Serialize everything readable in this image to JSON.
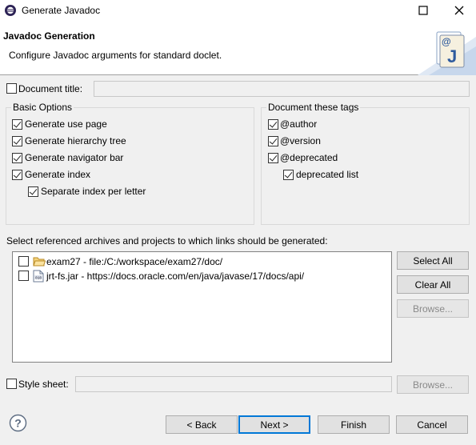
{
  "window": {
    "title": "Generate Javadoc",
    "maximize_icon": "maximize-icon",
    "close_icon": "close-icon"
  },
  "banner": {
    "title": "Javadoc Generation",
    "description": "Configure Javadoc arguments for standard doclet.",
    "image_icon": "javadoc-wizard-icon"
  },
  "document_title": {
    "label": "Document title:",
    "checked": false,
    "value": ""
  },
  "basic_options": {
    "title": "Basic Options",
    "items": [
      {
        "label": "Generate use page",
        "checked": true
      },
      {
        "label": "Generate hierarchy tree",
        "checked": true
      },
      {
        "label": "Generate navigator bar",
        "checked": true
      },
      {
        "label": "Generate index",
        "checked": true
      },
      {
        "label": "Separate index per letter",
        "checked": true
      }
    ]
  },
  "document_tags": {
    "title": "Document these tags",
    "items": [
      {
        "label": "@author",
        "checked": true
      },
      {
        "label": "@version",
        "checked": true
      },
      {
        "label": "@deprecated",
        "checked": true
      },
      {
        "label": "deprecated list",
        "checked": true
      }
    ]
  },
  "links": {
    "label": "Select referenced archives and projects to which links should be generated:",
    "items": [
      {
        "label": "exam27 - file:/C:/workspace/exam27/doc/",
        "icon": "folder-icon",
        "checked": false
      },
      {
        "label": "jrt-fs.jar - https://docs.oracle.com/en/java/javase/17/docs/api/",
        "icon": "jar-file-icon",
        "checked": false
      }
    ],
    "buttons": {
      "select_all": "Select All",
      "clear_all": "Clear All",
      "browse": "Browse..."
    }
  },
  "style_sheet": {
    "label": "Style sheet:",
    "checked": false,
    "value": "",
    "browse": "Browse..."
  },
  "footer": {
    "help_icon": "help-icon",
    "back": "< Back",
    "next": "Next >",
    "finish": "Finish",
    "cancel": "Cancel"
  }
}
